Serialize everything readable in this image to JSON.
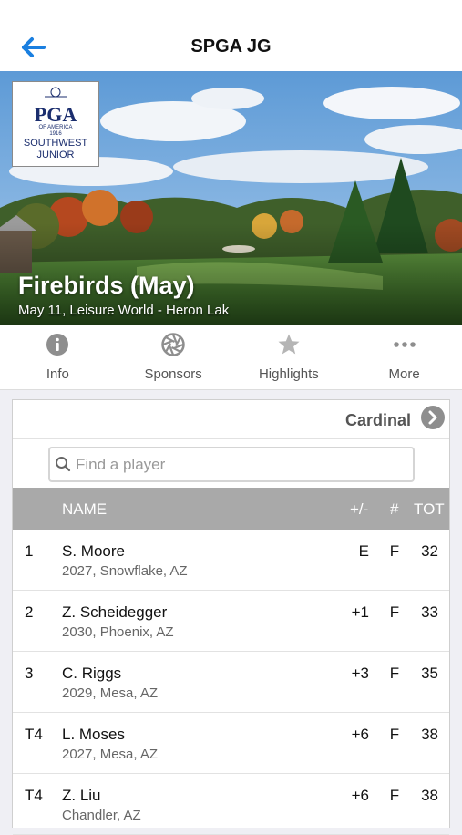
{
  "header": {
    "title": "SPGA JG"
  },
  "logo": {
    "line1": "PGA",
    "line2": "OF AMERICA",
    "line3": "1916",
    "line4": "SOUTHWEST",
    "line5": "JUNIOR"
  },
  "event": {
    "title": "Firebirds (May)",
    "subtitle": "May 11, Leisure World - Heron Lak"
  },
  "tabs": [
    {
      "label": "Info",
      "icon": "info-icon"
    },
    {
      "label": "Sponsors",
      "icon": "aperture-icon"
    },
    {
      "label": "Highlights",
      "icon": "star-icon"
    },
    {
      "label": "More",
      "icon": "ellipsis-icon"
    }
  ],
  "division": {
    "label": "Cardinal"
  },
  "search": {
    "placeholder": "Find a player",
    "value": ""
  },
  "table": {
    "headers": {
      "name": "NAME",
      "plus_minus": "+/-",
      "thru": "#",
      "total": "TOT"
    },
    "rows": [
      {
        "pos": "1",
        "name": "S. Moore",
        "sub": "2027, Snowflake, AZ",
        "plus_minus": "E",
        "thru": "F",
        "total": "32"
      },
      {
        "pos": "2",
        "name": "Z. Scheidegger",
        "sub": "2030, Phoenix, AZ",
        "plus_minus": "+1",
        "thru": "F",
        "total": "33"
      },
      {
        "pos": "3",
        "name": "C. Riggs",
        "sub": "2029, Mesa, AZ",
        "plus_minus": "+3",
        "thru": "F",
        "total": "35"
      },
      {
        "pos": "T4",
        "name": "L. Moses",
        "sub": "2027, Mesa, AZ",
        "plus_minus": "+6",
        "thru": "F",
        "total": "38"
      },
      {
        "pos": "T4",
        "name": "Z. Liu",
        "sub": "Chandler, AZ",
        "plus_minus": "+6",
        "thru": "F",
        "total": "38"
      }
    ]
  },
  "colors": {
    "accent": "#1a7fe0",
    "header_row": "#a9a9a9",
    "icon_gray": "#8e8e8e"
  }
}
